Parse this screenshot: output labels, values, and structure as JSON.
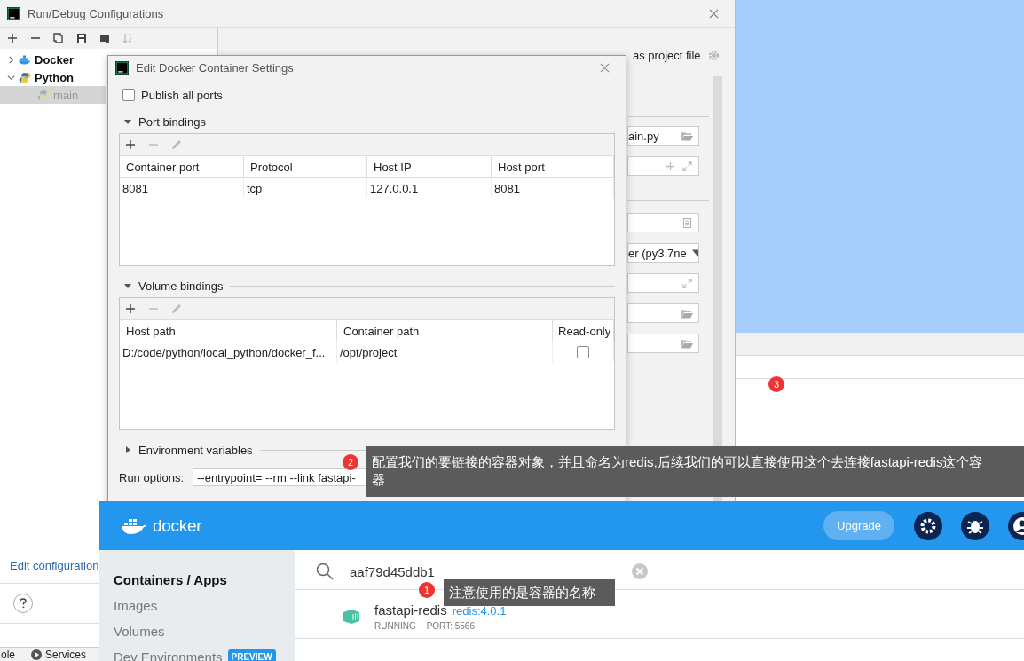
{
  "background": {
    "marker": "3"
  },
  "run_debug": {
    "title": "Run/Debug Configurations",
    "tree": [
      {
        "label": "Docker",
        "expanded": false,
        "selected": false
      },
      {
        "label": "Python",
        "expanded": true,
        "selected": false,
        "children": [
          {
            "label": "main",
            "selected": true
          }
        ]
      }
    ],
    "store_label": "as project file",
    "field_groups": [
      [
        {
          "kind": "file",
          "value": "ain.py"
        },
        {
          "kind": "add-expand"
        }
      ],
      [
        {
          "kind": "list"
        },
        {
          "kind": "dropdown",
          "value": "er (py3.7ne"
        },
        {
          "kind": "expand"
        },
        {
          "kind": "folder"
        },
        {
          "kind": "folder"
        }
      ]
    ],
    "edit_link": "Edit configuration",
    "bottom_tabs": [
      {
        "label": "ole"
      },
      {
        "label": "Services"
      }
    ]
  },
  "dialog": {
    "title": "Edit Docker Container Settings",
    "publish_all_ports": {
      "label": "Publish all ports",
      "checked": false
    },
    "port_bindings": {
      "title": "Port bindings",
      "expanded": true,
      "columns": [
        "Container port",
        "Protocol",
        "Host IP",
        "Host port"
      ],
      "rows": [
        [
          "8081",
          "tcp",
          "127.0.0.1",
          "8081"
        ]
      ]
    },
    "volume_bindings": {
      "title": "Volume bindings",
      "expanded": true,
      "columns": [
        "Host path",
        "Container path",
        "Read-only"
      ],
      "rows": [
        {
          "host_path": "D:/code/python/local_python/docker_f...",
          "container_path": "/opt/project",
          "read_only": false
        }
      ]
    },
    "environment": {
      "title": "Environment variables",
      "expanded": false
    },
    "run_options": {
      "label": "Run options:",
      "value": "--entrypoint= --rm --link  fastapi-"
    }
  },
  "docker": {
    "logo": "docker",
    "upgrade": "Upgrade",
    "sidebar": [
      {
        "label": "Containers / Apps",
        "selected": true
      },
      {
        "label": "Images",
        "selected": false
      },
      {
        "label": "Volumes",
        "selected": false
      },
      {
        "label": "Dev Environments",
        "selected": false,
        "badge": "PREVIEW"
      }
    ],
    "search": {
      "value": "aaf79d45ddb1"
    },
    "containers": [
      {
        "name": "fastapi-redis",
        "image": "redis:4.0.1",
        "status": "RUNNING",
        "port": "PORT: 5566"
      }
    ]
  },
  "callouts": [
    {
      "marker": "2",
      "text": "配置我们的要链接的容器对象，并且命名为redis,后续我们的可以直接使用这个去连接fastapi-redis这个容器"
    },
    {
      "marker": "1",
      "text": "注意使用的是容器的名称"
    }
  ]
}
